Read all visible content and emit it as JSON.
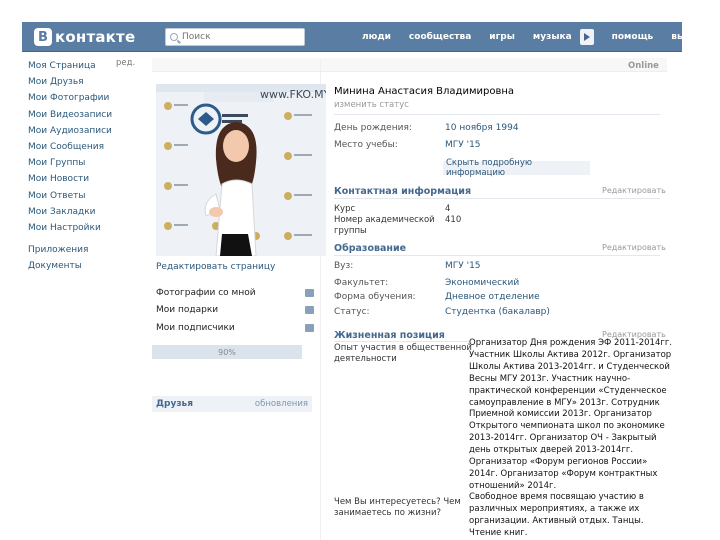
{
  "header": {
    "logo": "контакте",
    "search_placeholder": "Поиск",
    "nav": [
      "люди",
      "сообщества",
      "игры",
      "музыка",
      "помощь",
      "выйти"
    ]
  },
  "left_menu": [
    "Моя Страница",
    "Мои Друзья",
    "Мои Фотографии",
    "Мои Видеозаписи",
    "Мои Аудиозаписи",
    "Мои Сообщения",
    "Мои Группы",
    "Мои Новости",
    "Мои Ответы",
    "Мои Закладки",
    "Мои Настройки",
    "Приложения",
    "Документы"
  ],
  "left_menu_edit": "ред.",
  "profile": {
    "online": "Online",
    "name": "Минина Анастасия Владимировна",
    "change_status": "изменить статус",
    "photo_banner_text": "www.FKO.MY",
    "edit_page": "Редактировать страницу",
    "completeness": "90%",
    "show_details": "Скрыть подробную информацию",
    "info": [
      {
        "label": "День рождения:",
        "value": "10 ноября 1994"
      },
      {
        "label": "Место учебы:",
        "value": "МГУ '15"
      }
    ]
  },
  "side_links": [
    {
      "label": "Фотографии со мной",
      "icon": "camera-icon"
    },
    {
      "label": "Мои подарки",
      "icon": "gift-icon"
    },
    {
      "label": "Мои подписчики",
      "icon": "subscribers-icon"
    }
  ],
  "friends": {
    "title": "Друзья",
    "updates": "обновления"
  },
  "sections": {
    "contact": {
      "title": "Контактная информация",
      "edit": "Редактировать",
      "fields": [
        {
          "label": "Курс",
          "value": "4"
        },
        {
          "label": "Номер академической группы",
          "value": "410"
        }
      ]
    },
    "education": {
      "title": "Образование",
      "edit": "Редактировать",
      "fields": [
        {
          "label": "Вуз:",
          "value": "МГУ '15"
        },
        {
          "label": "Факультет:",
          "value": "Экономический"
        },
        {
          "label": "Форма обучения:",
          "value": "Дневное отделение"
        },
        {
          "label": "Статус:",
          "value": "Студентка (бакалавр)"
        }
      ]
    },
    "life_position": {
      "title": "Жизненная позиция",
      "edit": "Редактировать",
      "fields": [
        {
          "label": "Опыт участия в общественной деятельности",
          "value": "Организатор Дня рождения ЭФ 2011-2014гг. Участник Школы Актива 2012г. Организатор Школы Актива 2013-2014гг. и Студенческой Весны МГУ 2013г. Участник научно-практической конференции «Студенческое самоуправление в МГУ» 2013г. Сотрудник Приемной комиссии 2013г. Организатор Открытого чемпионата школ по экономике 2013-2014гг. Организатор ОЧ - Закрытый день открытых дверей 2013-2014гг. Организатор «Форум регионов России» 2014г. Организатор «Форум контрактных отношений» 2014г."
        },
        {
          "label": "Чем Вы интересуетесь? Чем занимаетесь по жизни?",
          "value": "Свободное время посвящаю участию в различных мероприятиях, а также их организации. Активный отдых. Танцы. Чтение книг."
        }
      ]
    }
  }
}
